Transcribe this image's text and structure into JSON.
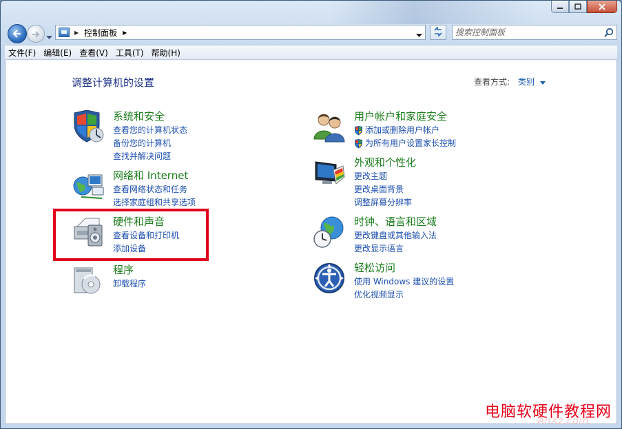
{
  "window": {
    "caption_buttons": {
      "minimize": "minimize-icon",
      "maximize": "maximize-icon",
      "close": "close-icon"
    }
  },
  "nav": {
    "address_path": "控制面板",
    "search_placeholder": "搜索控制面板"
  },
  "menu": [
    "文件(F)",
    "编辑(E)",
    "查看(V)",
    "工具(T)",
    "帮助(H)"
  ],
  "main": {
    "title": "调整计算机的设置",
    "view_by_label": "查看方式:",
    "view_by_value": "类别"
  },
  "categories": {
    "left": [
      {
        "title": "系统和安全",
        "icon": "shield-security-icon",
        "links": [
          {
            "text": "查看您的计算机状态"
          },
          {
            "text": "备份您的计算机"
          },
          {
            "text": "查找并解决问题"
          }
        ]
      },
      {
        "title": "网络和 Internet",
        "icon": "network-globe-icon",
        "links": [
          {
            "text": "查看网络状态和任务"
          },
          {
            "text": "选择家庭组和共享选项"
          }
        ]
      },
      {
        "title": "硬件和声音",
        "icon": "printer-speaker-icon",
        "links": [
          {
            "text": "查看设备和打印机"
          },
          {
            "text": "添加设备"
          }
        ]
      },
      {
        "title": "程序",
        "icon": "programs-disc-icon",
        "links": [
          {
            "text": "卸载程序"
          }
        ]
      }
    ],
    "right": [
      {
        "title": "用户帐户和家庭安全",
        "icon": "users-icon",
        "links": [
          {
            "text": "添加或删除用户帐户",
            "shield": true
          },
          {
            "text": "为所有用户设置家长控制",
            "shield": true
          }
        ]
      },
      {
        "title": "外观和个性化",
        "icon": "display-palette-icon",
        "links": [
          {
            "text": "更改主题"
          },
          {
            "text": "更改桌面背景"
          },
          {
            "text": "调整屏幕分辨率"
          }
        ]
      },
      {
        "title": "时钟、语言和区域",
        "icon": "clock-globe-icon",
        "links": [
          {
            "text": "更改键盘或其他输入法"
          },
          {
            "text": "更改显示语言"
          }
        ]
      },
      {
        "title": "轻松访问",
        "icon": "ease-of-access-icon",
        "links": [
          {
            "text": "使用 Windows 建议的设置"
          },
          {
            "text": "优化视频显示"
          }
        ]
      }
    ]
  },
  "watermark": {
    "text": "电脑软硬件教程网",
    "sub": "AnXz.com"
  },
  "colors": {
    "link": "#1e50b0",
    "category_title": "#1b7d1b",
    "heading": "#1e3287",
    "highlight": "#e0001b"
  }
}
